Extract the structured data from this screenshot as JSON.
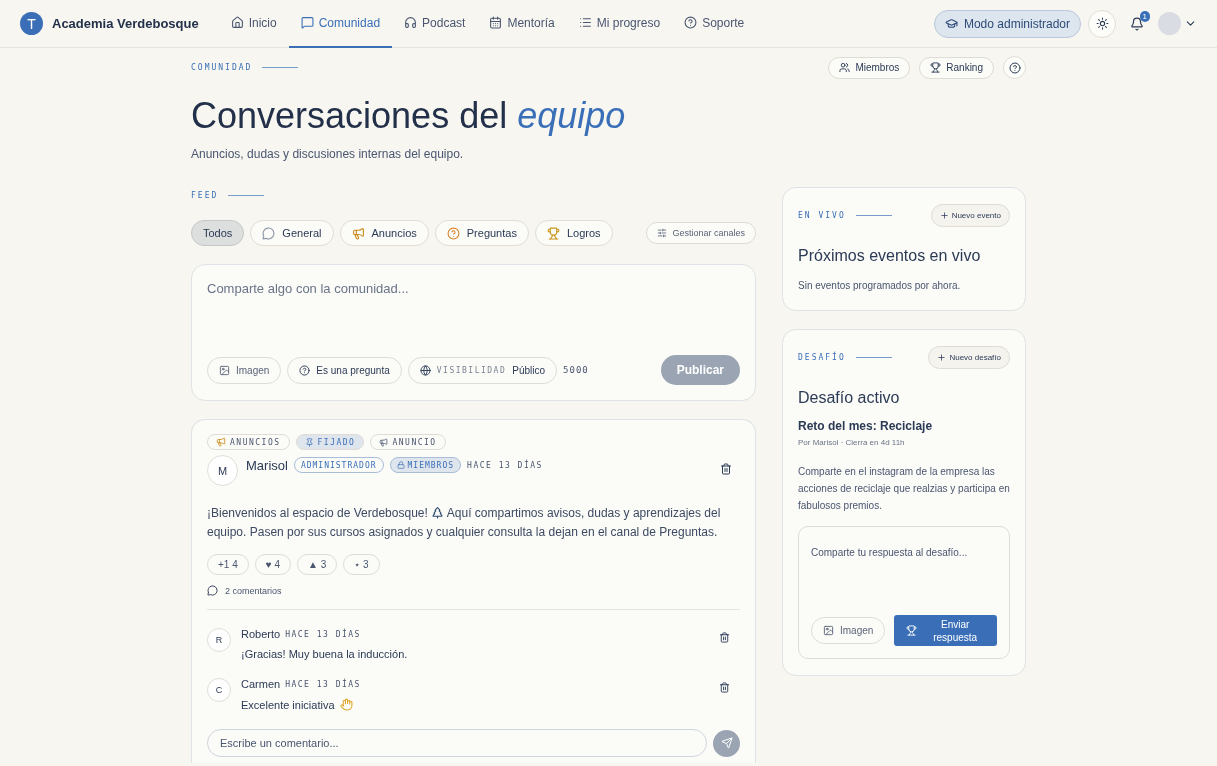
{
  "nav": {
    "logo_letter": "T",
    "brand": "Academia Verdebosque",
    "items": [
      {
        "label": "Inicio",
        "selected": false
      },
      {
        "label": "Comunidad",
        "selected": true
      },
      {
        "label": "Podcast",
        "selected": false
      },
      {
        "label": "Mentoría",
        "selected": false
      },
      {
        "label": "Mi progreso",
        "selected": false
      },
      {
        "label": "Soporte",
        "selected": false
      }
    ],
    "admin_button": "Modo administrador",
    "notification_count": "1"
  },
  "header": {
    "eyebrow": "COMUNIDAD",
    "title": "Conversaciones del",
    "title_accent": "equipo",
    "subtitle": "Anuncios, dudas y discusiones internas del equipo.",
    "actions": [
      "Miembros",
      "Ranking"
    ]
  },
  "feed": {
    "eyebrow": "FEED",
    "channels": [
      {
        "label": "Todos",
        "selected": true
      },
      {
        "label": "General",
        "selected": false
      },
      {
        "label": "Anuncios",
        "selected": false
      },
      {
        "label": "Preguntas",
        "selected": false
      },
      {
        "label": "Logros",
        "selected": false
      }
    ],
    "manage_button": "Gestionar canales",
    "composer": {
      "placeholder": "Comparte algo con la comunidad...",
      "image_button": "Imagen",
      "question_toggle": "Es una pregunta",
      "visibility_label": "VISIBILIDAD",
      "visibility_value": "Público",
      "char_count": "5000",
      "publish_button": "Publicar",
      "publish_disabled": true
    },
    "post": {
      "tags": [
        {
          "label": "ANUNCIOS",
          "kind": "channel"
        },
        {
          "label": "FIJADO",
          "kind": "pinned"
        },
        {
          "label": "ANUNCIO",
          "kind": "announcement"
        }
      ],
      "author_initial": "M",
      "author": "Marisol",
      "role": "ADMINISTRADOR",
      "audience": "MIEMBROS",
      "time": "HACE 13 DÍAS",
      "body_start": "¡Bienvenidos al espacio de Verdebosque!",
      "body_end": "Aquí compartimos avisos, dudas y aprendizajes del equipo. Pasen por sus cursos asignados y cualquier consulta la dejan en el canal de Preguntas.",
      "reactions": [
        {
          "symbol": "+1",
          "count": "4"
        },
        {
          "symbol": "♥",
          "count": "4"
        },
        {
          "symbol": "▲",
          "count": "3"
        },
        {
          "symbol": "⋆",
          "count": "3"
        }
      ],
      "comments_count": "2 comentarios",
      "comments": [
        {
          "initial": "R",
          "author": "Roberto",
          "time": "HACE 13 DÍAS",
          "text": "¡Gracias! Muy buena la inducción.",
          "emoji": false
        },
        {
          "initial": "C",
          "author": "Carmen",
          "time": "HACE 13 DÍAS",
          "text": "Excelente iniciativa",
          "emoji": true
        }
      ],
      "comment_placeholder": "Escribe un comentario..."
    }
  },
  "events": {
    "eyebrow": "EN VIVO",
    "button": "Nuevo evento",
    "title": "Próximos eventos en vivo",
    "empty": "Sin eventos programados por ahora."
  },
  "challenge": {
    "eyebrow": "DESAFÍO",
    "button": "Nuevo desafío",
    "title": "Desafío activo",
    "name": "Reto del mes: Reciclaje",
    "meta": "Por Marisol · Cierra en 4d 11h",
    "description": "Comparte en el instagram de la empresa las acciones de reciclaje que realzias y participa en fabulosos premios.",
    "placeholder": "Comparte tu respuesta al desafío...",
    "image_button": "Imagen",
    "submit_button": "Enviar respuesta"
  }
}
